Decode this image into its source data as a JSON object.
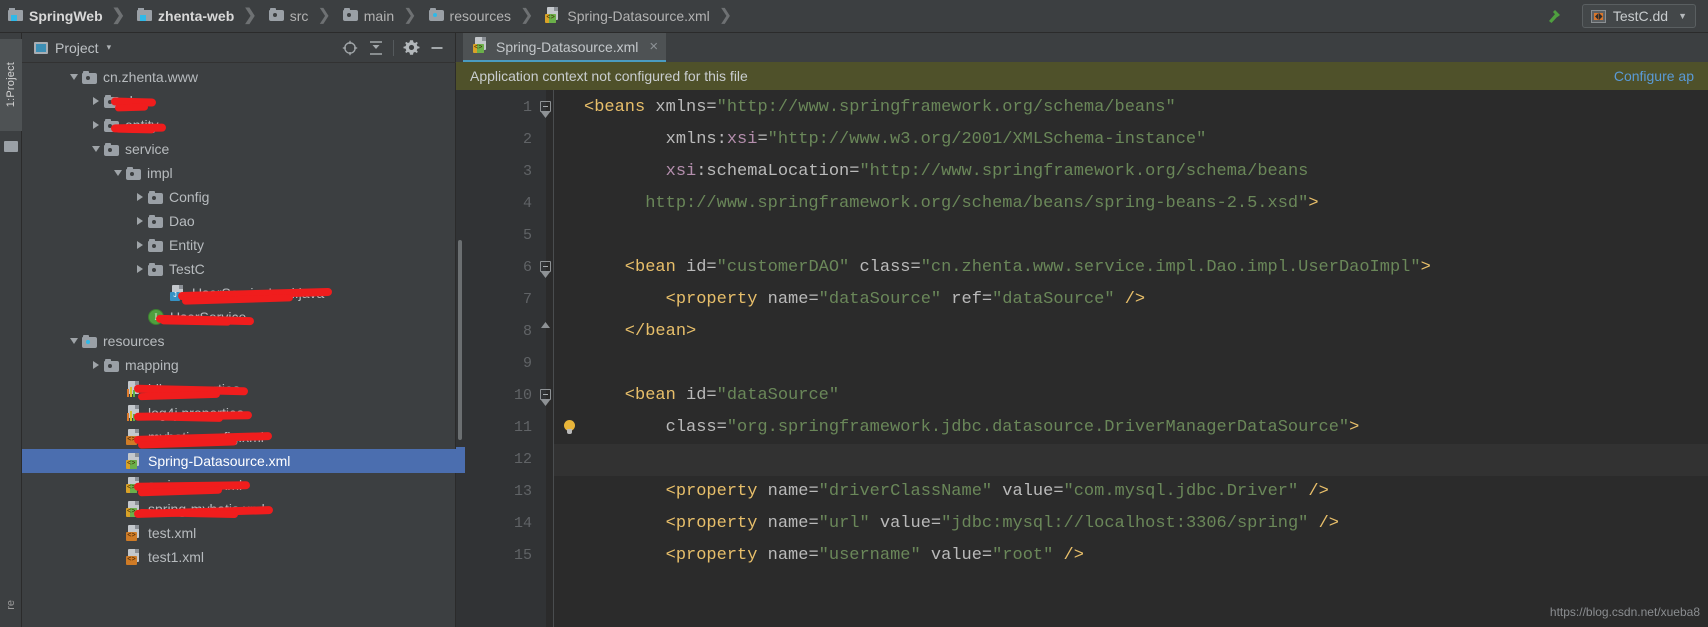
{
  "window": {
    "navbar": {
      "crumbs": [
        {
          "label": "SpringWeb",
          "icon": "module-icon",
          "bold": true
        },
        {
          "label": "zhenta-web",
          "icon": "module-icon",
          "bold": true
        },
        {
          "label": "src",
          "icon": "folder-icon",
          "bold": false
        },
        {
          "label": "main",
          "icon": "folder-icon",
          "bold": false
        },
        {
          "label": "resources",
          "icon": "source-folder-icon",
          "bold": false
        },
        {
          "label": "Spring-Datasource.xml",
          "icon": "spring-xml-icon",
          "bold": false
        }
      ],
      "hammer_icon": "build-hammer-icon",
      "run_config": {
        "label": "TestC.dd",
        "icon": "run-config-icon",
        "caret": "▼"
      }
    }
  },
  "toolstrip": {
    "project_tab": "1:Project",
    "bottom_tab": "re"
  },
  "project_panel": {
    "header": {
      "title": "Project",
      "caret": "▾",
      "buttons": [
        {
          "name": "locate-in-tree-button",
          "icon": "crosshair-icon"
        },
        {
          "name": "collapse-all-button",
          "icon": "collapse-all-icon"
        },
        {
          "name": "settings-button",
          "icon": "gear-icon"
        },
        {
          "name": "hide-button",
          "icon": "minus-icon"
        }
      ]
    },
    "tree": [
      {
        "label": "cn.zhenta.www",
        "icon": "folder-icon",
        "indent": 2,
        "twisty": "down",
        "struck": false,
        "selected": false
      },
      {
        "label": "dao",
        "icon": "folder-icon",
        "indent": 3,
        "twisty": "right",
        "struck": true,
        "selected": false
      },
      {
        "label": "entity",
        "icon": "folder-icon",
        "indent": 3,
        "twisty": "right",
        "struck": true,
        "selected": false
      },
      {
        "label": "service",
        "icon": "folder-icon",
        "indent": 3,
        "twisty": "down",
        "struck": false,
        "selected": false
      },
      {
        "label": "impl",
        "icon": "folder-icon",
        "indent": 4,
        "twisty": "down",
        "struck": false,
        "selected": false
      },
      {
        "label": "Config",
        "icon": "folder-icon",
        "indent": 5,
        "twisty": "right",
        "struck": false,
        "selected": false
      },
      {
        "label": "Dao",
        "icon": "folder-icon",
        "indent": 5,
        "twisty": "right",
        "struck": false,
        "selected": false
      },
      {
        "label": "Entity",
        "icon": "folder-icon",
        "indent": 5,
        "twisty": "right",
        "struck": false,
        "selected": false
      },
      {
        "label": "TestC",
        "icon": "folder-icon",
        "indent": 5,
        "twisty": "right",
        "struck": false,
        "selected": false
      },
      {
        "label": "UserServiceImpl.java",
        "icon": "java-class-icon",
        "indent": 6,
        "twisty": "none",
        "struck": true,
        "selected": false
      },
      {
        "label": "UserService",
        "icon": "java-interface-icon",
        "indent": 5,
        "twisty": "none",
        "struck": true,
        "selected": false
      },
      {
        "label": "resources",
        "icon": "source-folder-icon",
        "indent": 2,
        "twisty": "down",
        "struck": false,
        "selected": false
      },
      {
        "label": "mapping",
        "icon": "folder-icon",
        "indent": 3,
        "twisty": "right",
        "struck": false,
        "selected": false
      },
      {
        "label": "jdbc.properties",
        "icon": "properties-icon",
        "indent": 4,
        "twisty": "none",
        "struck": true,
        "selected": false
      },
      {
        "label": "log4j.properties",
        "icon": "properties-icon",
        "indent": 4,
        "twisty": "none",
        "struck": true,
        "selected": false
      },
      {
        "label": "mybatis-config.xml",
        "icon": "xml-icon",
        "indent": 4,
        "twisty": "none",
        "struck": true,
        "selected": false
      },
      {
        "label": "Spring-Datasource.xml",
        "icon": "spring-xml-icon",
        "indent": 4,
        "twisty": "none",
        "struck": false,
        "selected": true
      },
      {
        "label": "spring-mvc.xml",
        "icon": "spring-xml-icon",
        "indent": 4,
        "twisty": "none",
        "struck": true,
        "selected": false
      },
      {
        "label": "spring-mybatis.xml",
        "icon": "spring-xml-icon",
        "indent": 4,
        "twisty": "none",
        "struck": true,
        "selected": false
      },
      {
        "label": "test.xml",
        "icon": "xml-icon",
        "indent": 4,
        "twisty": "none",
        "struck": false,
        "selected": false
      },
      {
        "label": "test1.xml",
        "icon": "xml-icon",
        "indent": 4,
        "twisty": "none",
        "struck": false,
        "selected": false
      }
    ]
  },
  "editor": {
    "tab": {
      "label": "Spring-Datasource.xml",
      "icon": "spring-xml-icon",
      "close": "×"
    },
    "notification": {
      "message": "Application context not configured for this file",
      "link": "Configure ap"
    },
    "caret_line": 12,
    "bulb_line": 11,
    "lines": [
      {
        "n": 1,
        "fold": "start",
        "segments": [
          {
            "t": "<",
            "c": "tag"
          },
          {
            "t": "beans",
            "c": "tag"
          },
          {
            "t": " xmlns=",
            "c": "attr"
          },
          {
            "t": "\"http://www.springframework.org/schema/beans\"",
            "c": "str"
          }
        ]
      },
      {
        "n": 2,
        "fold": "none",
        "segments": [
          {
            "t": "        xmlns:",
            "c": "attr"
          },
          {
            "t": "xsi",
            "c": "ns"
          },
          {
            "t": "=",
            "c": "attr"
          },
          {
            "t": "\"http://www.w3.org/2001/XMLSchema-instance\"",
            "c": "str"
          }
        ]
      },
      {
        "n": 3,
        "fold": "none",
        "segments": [
          {
            "t": "        ",
            "c": "plain"
          },
          {
            "t": "xsi",
            "c": "ns"
          },
          {
            "t": ":schemaLocation=",
            "c": "attr"
          },
          {
            "t": "\"http://www.springframework.org/schema/beans",
            "c": "str"
          }
        ]
      },
      {
        "n": 4,
        "fold": "none",
        "segments": [
          {
            "t": "      http://www.springframework.org/schema/beans/spring-beans-2.5.xsd\"",
            "c": "str"
          },
          {
            "t": ">",
            "c": "tag"
          }
        ]
      },
      {
        "n": 5,
        "fold": "none",
        "segments": []
      },
      {
        "n": 6,
        "fold": "start",
        "segments": [
          {
            "t": "    <",
            "c": "tag"
          },
          {
            "t": "bean",
            "c": "tag"
          },
          {
            "t": " id=",
            "c": "attr"
          },
          {
            "t": "\"customerDAO\"",
            "c": "str"
          },
          {
            "t": " class=",
            "c": "attr"
          },
          {
            "t": "\"cn.zhenta.www.service.impl.Dao.impl.UserDaoImpl\"",
            "c": "str"
          },
          {
            "t": ">",
            "c": "tag"
          }
        ]
      },
      {
        "n": 7,
        "fold": "none",
        "segments": [
          {
            "t": "        <",
            "c": "tag"
          },
          {
            "t": "property",
            "c": "tag"
          },
          {
            "t": " name=",
            "c": "attr"
          },
          {
            "t": "\"dataSource\"",
            "c": "str"
          },
          {
            "t": " ref=",
            "c": "attr"
          },
          {
            "t": "\"dataSource\"",
            "c": "str"
          },
          {
            "t": " />",
            "c": "tag"
          }
        ]
      },
      {
        "n": 8,
        "fold": "end",
        "segments": [
          {
            "t": "    </",
            "c": "tag"
          },
          {
            "t": "bean",
            "c": "tag"
          },
          {
            "t": ">",
            "c": "tag"
          }
        ]
      },
      {
        "n": 9,
        "fold": "none",
        "segments": []
      },
      {
        "n": 10,
        "fold": "start",
        "segments": [
          {
            "t": "    <",
            "c": "tag"
          },
          {
            "t": "bean",
            "c": "tag"
          },
          {
            "t": " id=",
            "c": "attr"
          },
          {
            "t": "\"dataSource\"",
            "c": "str"
          }
        ]
      },
      {
        "n": 11,
        "fold": "none",
        "segments": [
          {
            "t": "        class=",
            "c": "attr"
          },
          {
            "t": "\"org.springframework.jdbc.datasource.DriverManagerDataSource\"",
            "c": "str"
          },
          {
            "t": ">",
            "c": "tag"
          }
        ]
      },
      {
        "n": 12,
        "fold": "none",
        "segments": []
      },
      {
        "n": 13,
        "fold": "none",
        "segments": [
          {
            "t": "        <",
            "c": "tag"
          },
          {
            "t": "property",
            "c": "tag"
          },
          {
            "t": " name=",
            "c": "attr"
          },
          {
            "t": "\"driverClassName\"",
            "c": "str"
          },
          {
            "t": " value=",
            "c": "attr"
          },
          {
            "t": "\"com.mysql.jdbc.Driver\"",
            "c": "str"
          },
          {
            "t": " />",
            "c": "tag"
          }
        ]
      },
      {
        "n": 14,
        "fold": "none",
        "segments": [
          {
            "t": "        <",
            "c": "tag"
          },
          {
            "t": "property",
            "c": "tag"
          },
          {
            "t": " name=",
            "c": "attr"
          },
          {
            "t": "\"url\"",
            "c": "str"
          },
          {
            "t": " value=",
            "c": "attr"
          },
          {
            "t": "\"jdbc:mysql://localhost:3306/spring\"",
            "c": "str"
          },
          {
            "t": " />",
            "c": "tag"
          }
        ]
      },
      {
        "n": 15,
        "fold": "none",
        "segments": [
          {
            "t": "        <",
            "c": "tag"
          },
          {
            "t": "property",
            "c": "tag"
          },
          {
            "t": " name=",
            "c": "attr"
          },
          {
            "t": "\"username\"",
            "c": "str"
          },
          {
            "t": " value=",
            "c": "attr"
          },
          {
            "t": "\"root\"",
            "c": "str"
          },
          {
            "t": " />",
            "c": "tag"
          }
        ]
      }
    ]
  },
  "watermark": "https://blog.csdn.net/xueba8",
  "colors": {
    "background": "#3c3f41",
    "editor_bg": "#2b2b2b",
    "selection": "#4b6eaf",
    "notification_bg": "#4f512a",
    "accent_link": "#5a9ad6",
    "annotation_red": "#f01d1d",
    "tab_underline": "#4a9bc0"
  }
}
